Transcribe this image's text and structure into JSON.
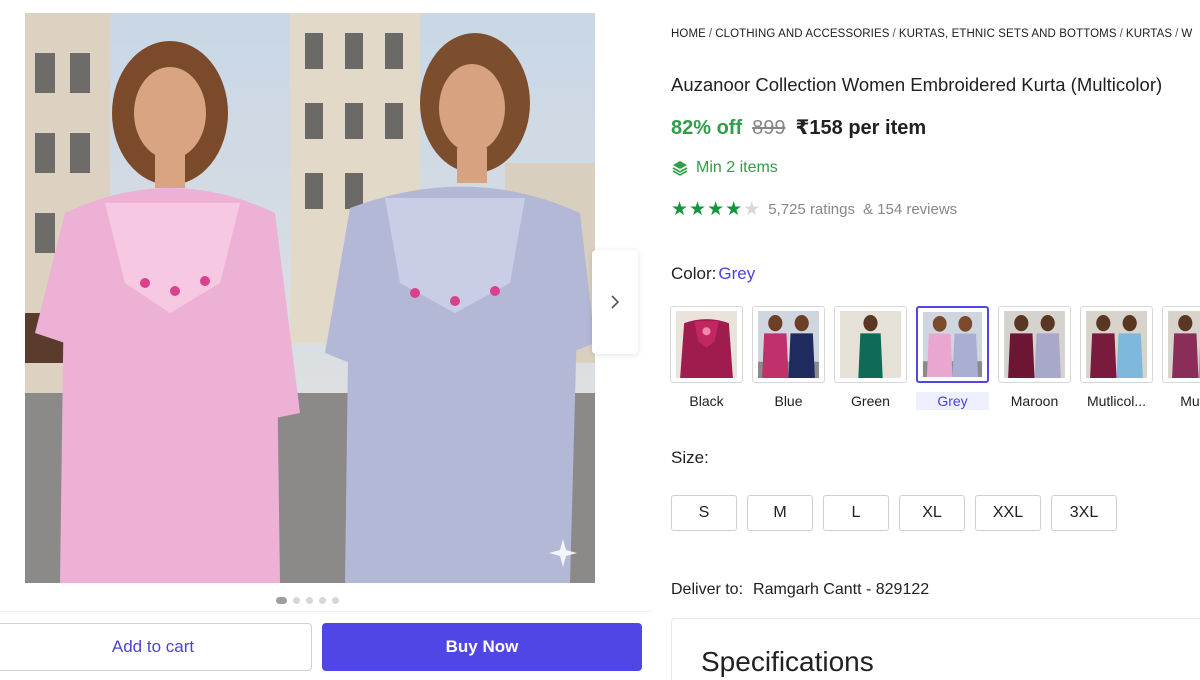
{
  "breadcrumb": [
    "HOME",
    "CLOTHING AND ACCESSORIES",
    "KURTAS, ETHNIC SETS AND BOTTOMS",
    "KURTAS",
    "W"
  ],
  "product": {
    "title": "Auzanoor Collection Women Embroidered Kurta (Multicolor)",
    "discount": "82% off",
    "mrp": "899",
    "price": "₹158 per item",
    "min_items": "Min 2 items",
    "rating": {
      "stars_filled": 4,
      "stars_total": 5,
      "ratings_text": "5,725 ratings",
      "reviews_text": "& 154 reviews"
    }
  },
  "gallery": {
    "image_count": 5,
    "active_index": 0,
    "next_icon": "chevron-right-icon"
  },
  "color": {
    "label": "Color:",
    "selected": "Grey",
    "options": [
      {
        "name": "Black",
        "colors": [
          "#a01c4f",
          "#c2275f"
        ]
      },
      {
        "name": "Blue",
        "colors": [
          "#c0306a",
          "#1f2a5e"
        ]
      },
      {
        "name": "Green",
        "colors": [
          "#0f6b56",
          "#0f6b56"
        ]
      },
      {
        "name": "Grey",
        "colors": [
          "#e9a6cf",
          "#a9aed3"
        ]
      },
      {
        "name": "Maroon",
        "colors": [
          "#6c1634",
          "#a8a8c8"
        ]
      },
      {
        "name": "Mutlicol...",
        "colors": [
          "#7a1a3c",
          "#7fb8dc"
        ]
      },
      {
        "name": "Mutlic",
        "colors": [
          "#8a2d58",
          "#c08aa6"
        ]
      }
    ]
  },
  "size": {
    "label": "Size:",
    "options": [
      "S",
      "M",
      "L",
      "XL",
      "XXL",
      "3XL"
    ]
  },
  "delivery": {
    "label": "Deliver to:",
    "location": "Ramgarh Cantt - 829122"
  },
  "buttons": {
    "add_to_cart": "Add to cart",
    "buy_now": "Buy Now"
  },
  "specifications": {
    "title": "Specifications"
  },
  "colors": {
    "accent": "#4f46e5",
    "discount": "#2e9e48",
    "star": "#14963c"
  }
}
